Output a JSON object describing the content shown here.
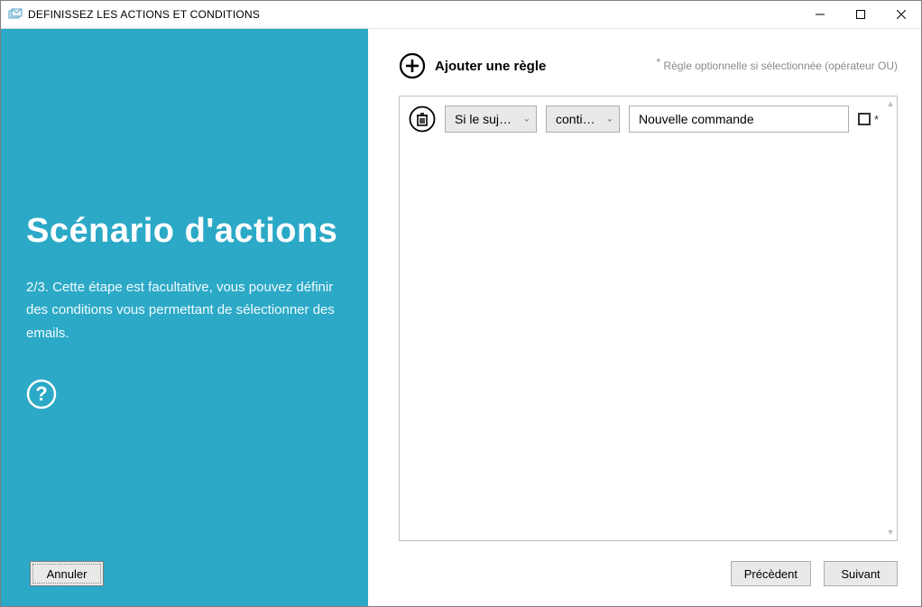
{
  "window": {
    "title": "DEFINISSEZ LES ACTIONS ET CONDITIONS"
  },
  "sidebar": {
    "heading": "Scénario d'actions",
    "description": "2/3. Cette étape est facultative, vous pouvez définir des conditions vous permettant de sélectionner des emails.",
    "cancel_label": "Annuler"
  },
  "main": {
    "add_rule_label": "Ajouter une règle",
    "hint_text": "Règle optionnelle si sélectionnée (opérateur OU)",
    "rules": [
      {
        "field_label": "Si le sujet...",
        "operator_label": "contient",
        "value": "Nouvelle commande",
        "optional_checked": false
      }
    ]
  },
  "footer": {
    "prev_label": "Précèdent",
    "next_label": "Suivant"
  }
}
